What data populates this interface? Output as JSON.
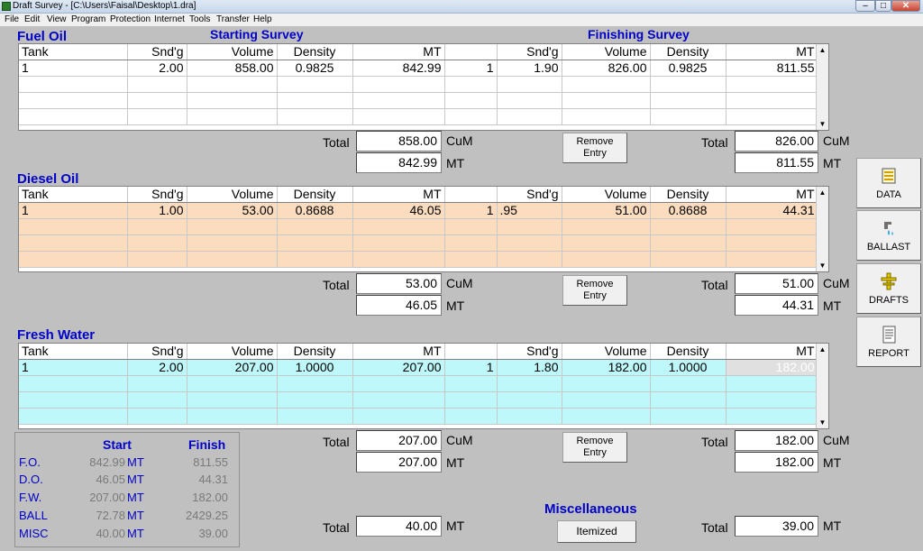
{
  "window": {
    "title": "Draft Survey - [C:\\Users\\Faisal\\Desktop\\1.dra]",
    "min": "‒",
    "max": "□",
    "close": "✕"
  },
  "menu": [
    "File",
    "Edit",
    "View",
    "Program",
    "Protection",
    "Internet",
    "Tools",
    "Transfer",
    "Help"
  ],
  "headings": {
    "starting": "Starting Survey",
    "finishing": "Finishing Survey"
  },
  "columns": [
    "Tank",
    "Snd'g",
    "Volume",
    "Density",
    "MT",
    "Snd'g",
    "Volume",
    "Density",
    "MT"
  ],
  "sections": {
    "fuel_oil": {
      "title": "Fuel Oil",
      "rows": [
        [
          "1",
          "2.00",
          "858.00",
          "0.9825",
          "842.99",
          "1",
          "1.90",
          "826.00",
          "0.9825",
          "811.55"
        ]
      ],
      "start_total_cum": "858.00",
      "start_total_mt": "842.99",
      "finish_total_cum": "826.00",
      "finish_total_mt": "811.55"
    },
    "diesel_oil": {
      "title": "Diesel Oil",
      "rows": [
        [
          "1",
          "1.00",
          "53.00",
          "0.8688",
          "46.05",
          "1",
          ".95",
          "51.00",
          "0.8688",
          "44.31"
        ]
      ],
      "start_total_cum": "53.00",
      "start_total_mt": "46.05",
      "finish_total_cum": "51.00",
      "finish_total_mt": "44.31"
    },
    "fresh_water": {
      "title": "Fresh Water",
      "rows": [
        [
          "1",
          "2.00",
          "207.00",
          "1.0000",
          "207.00",
          "1",
          "1.80",
          "182.00",
          "1.0000",
          "182.00"
        ]
      ],
      "start_total_cum": "207.00",
      "start_total_mt": "207.00",
      "finish_total_cum": "182.00",
      "finish_total_mt": "182.00"
    }
  },
  "labels": {
    "total": "Total",
    "cum": "CuM",
    "mt": "MT",
    "remove": "Remove",
    "entry": "Entry"
  },
  "misc": {
    "title": "Miscellaneous",
    "button": "Itemized",
    "start_total": "40.00",
    "finish_total": "39.00"
  },
  "side": [
    {
      "label": "DATA",
      "icon": "data-icon"
    },
    {
      "label": "BALLAST",
      "icon": "ballast-icon"
    },
    {
      "label": "DRAFTS",
      "icon": "drafts-icon"
    },
    {
      "label": "REPORT",
      "icon": "report-icon"
    }
  ],
  "summary": {
    "start": "Start",
    "finish": "Finish",
    "unit": "MT",
    "rows": [
      {
        "key": "F.O.",
        "start": "842.99",
        "finish": "811.55"
      },
      {
        "key": "D.O.",
        "start": "46.05",
        "finish": "44.31"
      },
      {
        "key": "F.W.",
        "start": "207.00",
        "finish": "182.00"
      },
      {
        "key": "BALL",
        "start": "72.78",
        "finish": "2429.25"
      },
      {
        "key": "MISC",
        "start": "40.00",
        "finish": "39.00"
      }
    ]
  },
  "colors": {
    "heading": "#0000c8",
    "diesel_row": "#fcdcbf",
    "water_row": "#bff8fa",
    "background": "#c0c0c0"
  }
}
